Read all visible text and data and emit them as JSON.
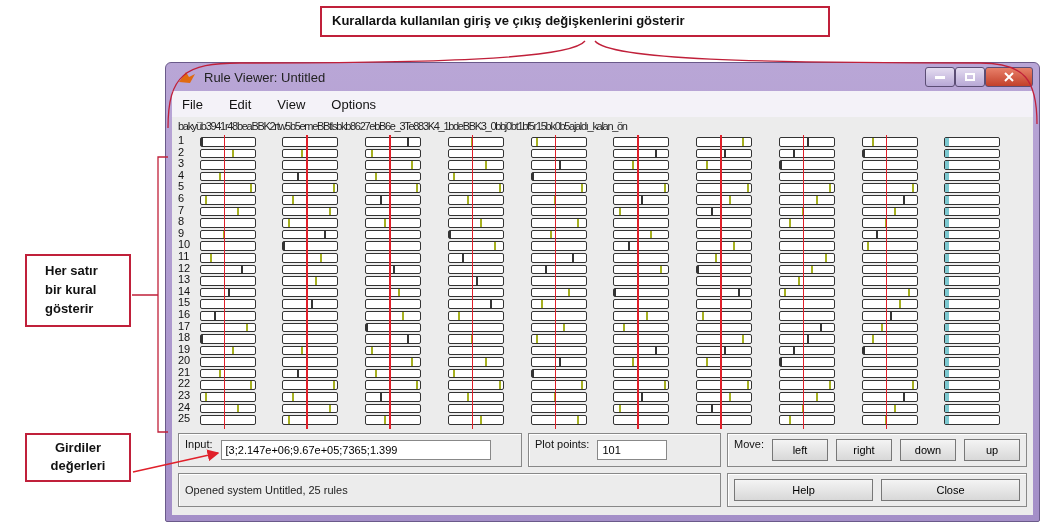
{
  "top_callout": {
    "text": "Kurallarda kullanılan giriş ve çıkış değişkenlerini gösterir"
  },
  "left_callouts": [
    {
      "kind": "bracket",
      "text": "Her satır bir kural gösterir"
    },
    {
      "kind": "arrow",
      "text": "Girdiler değerleri"
    }
  ],
  "window": {
    "title": "Rule Viewer: Untitled"
  },
  "menu": [
    "File",
    "Edit",
    "View",
    "Options"
  ],
  "variable_header": "bakyüb3941r48beaBBK2rtw5b5emeBBtlsbkb8627ebB6e_3Te883K4_1bdeBBK3_0bbj0bt1bf5r15bk0b5ajaldı_kalan_ön",
  "rules": [
    "1",
    "2",
    "3",
    "4",
    "5",
    "6",
    "7",
    "8",
    "9",
    "10",
    "11",
    "12",
    "13",
    "14",
    "15",
    "16",
    "17",
    "18",
    "19",
    "20",
    "21",
    "22",
    "23",
    "24",
    "25"
  ],
  "columns": [
    {
      "kind": "input"
    },
    {
      "kind": "input"
    },
    {
      "kind": "input"
    },
    {
      "kind": "input"
    },
    {
      "kind": "input"
    },
    {
      "kind": "input"
    },
    {
      "kind": "input"
    },
    {
      "kind": "input"
    },
    {
      "kind": "input"
    },
    {
      "kind": "output"
    }
  ],
  "input": {
    "label": "Input:",
    "value": "[3;2.147e+06;9.67e+05;7365;1.399"
  },
  "plot_points": {
    "label": "Plot points:",
    "value": "101"
  },
  "move": {
    "label": "Move:",
    "buttons": [
      "left",
      "right",
      "down",
      "up"
    ]
  },
  "status": "Opened system Untitled, 25 rules",
  "buttons": [
    "Help",
    "Close"
  ]
}
